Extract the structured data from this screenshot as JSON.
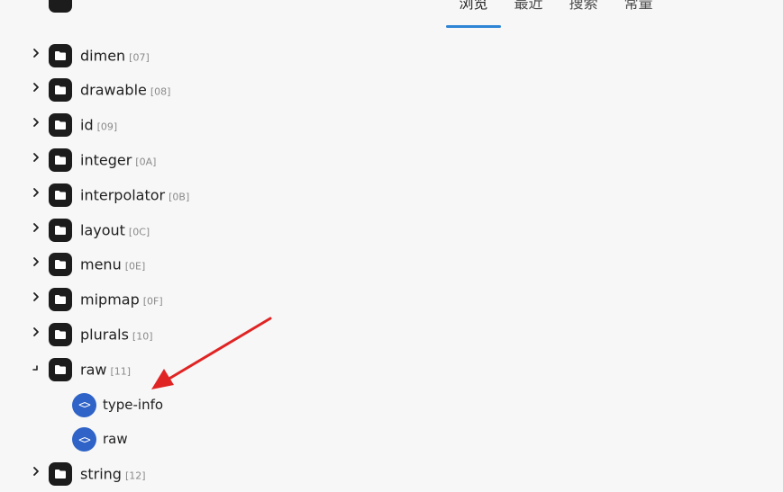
{
  "tabs": [
    {
      "label": "浏览",
      "active": true
    },
    {
      "label": "最近",
      "active": false
    },
    {
      "label": "搜索",
      "active": false
    },
    {
      "label": "常量",
      "active": false
    }
  ],
  "tree": [
    {
      "name": "dimen",
      "code": "[07]",
      "expanded": false
    },
    {
      "name": "drawable",
      "code": "[08]",
      "expanded": false
    },
    {
      "name": "id",
      "code": "[09]",
      "expanded": false
    },
    {
      "name": "integer",
      "code": "[0A]",
      "expanded": false
    },
    {
      "name": "interpolator",
      "code": "[0B]",
      "expanded": false
    },
    {
      "name": "layout",
      "code": "[0C]",
      "expanded": false
    },
    {
      "name": "menu",
      "code": "[0E]",
      "expanded": false
    },
    {
      "name": "mipmap",
      "code": "[0F]",
      "expanded": false
    },
    {
      "name": "plurals",
      "code": "[10]",
      "expanded": false
    },
    {
      "name": "raw",
      "code": "[11]",
      "expanded": true
    },
    {
      "file": "type-info",
      "icon": "<>"
    },
    {
      "file": "raw",
      "icon": "<>"
    },
    {
      "name": "string",
      "code": "[12]",
      "expanded": false
    }
  ],
  "colors": {
    "accent": "#2f84d6",
    "file_icon": "#2f63c7",
    "arrow": "#e02424"
  }
}
